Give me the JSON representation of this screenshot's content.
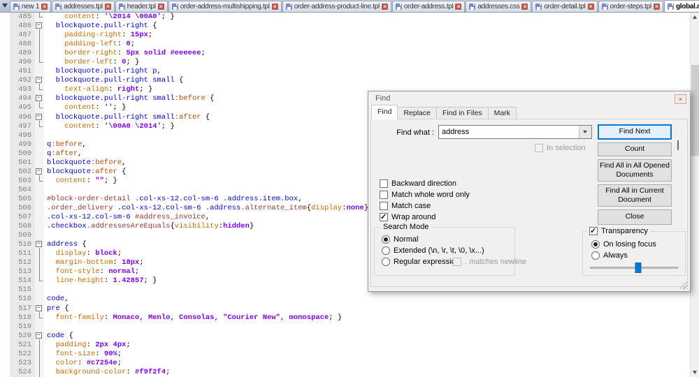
{
  "colors": {
    "accent": "#0078d7",
    "syntax_selector": "#0000e8",
    "syntax_property": "#cc6a00",
    "syntax_value": "#8000ff",
    "syntax_pseudo": "#c04800",
    "syntax_unknown": "#993333",
    "tab_close": "#c0564a",
    "tab_icon": "#8087c8"
  },
  "tabbar": {
    "tabs": [
      {
        "label": "new 1",
        "active": false
      },
      {
        "label": "addresses.tpl",
        "active": false
      },
      {
        "label": "header.tpl",
        "active": false
      },
      {
        "label": "order-address-multishipping.tpl",
        "active": false
      },
      {
        "label": "order-address-product-line.tpl",
        "active": false
      },
      {
        "label": "order-address.tpl",
        "active": false
      },
      {
        "label": "addresses.css",
        "active": false
      },
      {
        "label": "order-detail.tpl",
        "active": false
      },
      {
        "label": "order-steps.tpl",
        "active": false
      },
      {
        "label": "global.css",
        "active": true
      }
    ]
  },
  "editor": {
    "lines": [
      {
        "num": 485,
        "fold": "end",
        "segs": [
          [
            "pln",
            "    "
          ],
          [
            "prop",
            "content"
          ],
          [
            "pln",
            ": "
          ],
          [
            "val",
            "'\\2014 \\00A0'"
          ],
          [
            "pln",
            "; }"
          ]
        ]
      },
      {
        "num": 486,
        "fold": "box",
        "segs": [
          [
            "pln",
            "  "
          ],
          [
            "sel",
            "blockquote.pull-right"
          ],
          [
            "pln",
            " {"
          ]
        ]
      },
      {
        "num": 487,
        "fold": "line",
        "segs": [
          [
            "pln",
            "    "
          ],
          [
            "prop",
            "padding-right"
          ],
          [
            "pln",
            ": "
          ],
          [
            "val",
            "15px"
          ],
          [
            "pln",
            ";"
          ]
        ]
      },
      {
        "num": 488,
        "fold": "line",
        "segs": [
          [
            "pln",
            "    "
          ],
          [
            "prop",
            "padding-left"
          ],
          [
            "pln",
            ": "
          ],
          [
            "val",
            "0"
          ],
          [
            "pln",
            ";"
          ]
        ]
      },
      {
        "num": 489,
        "fold": "line",
        "segs": [
          [
            "pln",
            "    "
          ],
          [
            "prop",
            "border-right"
          ],
          [
            "pln",
            ": "
          ],
          [
            "val",
            "5px solid #eeeeee"
          ],
          [
            "pln",
            ";"
          ]
        ]
      },
      {
        "num": 490,
        "fold": "end",
        "segs": [
          [
            "pln",
            "    "
          ],
          [
            "prop",
            "border-left"
          ],
          [
            "pln",
            ": "
          ],
          [
            "val",
            "0"
          ],
          [
            "pln",
            "; }"
          ]
        ]
      },
      {
        "num": 491,
        "fold": "none",
        "segs": [
          [
            "pln",
            "  "
          ],
          [
            "sel",
            "blockquote.pull-right p"
          ],
          [
            "pln",
            ","
          ]
        ]
      },
      {
        "num": 492,
        "fold": "box",
        "segs": [
          [
            "pln",
            "  "
          ],
          [
            "sel",
            "blockquote.pull-right small"
          ],
          [
            "pln",
            " {"
          ]
        ]
      },
      {
        "num": 493,
        "fold": "end",
        "segs": [
          [
            "pln",
            "    "
          ],
          [
            "prop",
            "text-align"
          ],
          [
            "pln",
            ": "
          ],
          [
            "val",
            "right"
          ],
          [
            "pln",
            "; }"
          ]
        ]
      },
      {
        "num": 494,
        "fold": "box",
        "segs": [
          [
            "pln",
            "  "
          ],
          [
            "sel",
            "blockquote.pull-right small"
          ],
          [
            "pse",
            ":before"
          ],
          [
            "pln",
            " {"
          ]
        ]
      },
      {
        "num": 495,
        "fold": "end",
        "segs": [
          [
            "pln",
            "    "
          ],
          [
            "prop",
            "content"
          ],
          [
            "pln",
            ": "
          ],
          [
            "val",
            "''"
          ],
          [
            "pln",
            "; }"
          ]
        ]
      },
      {
        "num": 496,
        "fold": "box",
        "segs": [
          [
            "pln",
            "  "
          ],
          [
            "sel",
            "blockquote.pull-right small"
          ],
          [
            "pse",
            ":after"
          ],
          [
            "pln",
            " {"
          ]
        ]
      },
      {
        "num": 497,
        "fold": "end",
        "segs": [
          [
            "pln",
            "    "
          ],
          [
            "prop",
            "content"
          ],
          [
            "pln",
            ": "
          ],
          [
            "val",
            "'\\00A0 \\2014'"
          ],
          [
            "pln",
            "; }"
          ]
        ]
      },
      {
        "num": 498,
        "fold": "none",
        "segs": []
      },
      {
        "num": 499,
        "fold": "none",
        "segs": [
          [
            "sel",
            "q"
          ],
          [
            "pse",
            ":before"
          ],
          [
            "pln",
            ","
          ]
        ]
      },
      {
        "num": 500,
        "fold": "none",
        "segs": [
          [
            "sel",
            "q"
          ],
          [
            "pse",
            ":after"
          ],
          [
            "pln",
            ","
          ]
        ]
      },
      {
        "num": 501,
        "fold": "none",
        "segs": [
          [
            "sel",
            "blockquote"
          ],
          [
            "pse",
            ":before"
          ],
          [
            "pln",
            ","
          ]
        ]
      },
      {
        "num": 502,
        "fold": "box",
        "segs": [
          [
            "sel",
            "blockquote"
          ],
          [
            "pse",
            ":after"
          ],
          [
            "pln",
            " {"
          ]
        ]
      },
      {
        "num": 503,
        "fold": "end",
        "segs": [
          [
            "pln",
            "  "
          ],
          [
            "prop",
            "content"
          ],
          [
            "pln",
            ": "
          ],
          [
            "val",
            "\"\""
          ],
          [
            "pln",
            "; }"
          ]
        ]
      },
      {
        "num": 504,
        "fold": "none",
        "segs": []
      },
      {
        "num": 505,
        "fold": "none",
        "segs": [
          [
            "unk",
            "#block-order-detail"
          ],
          [
            "pln",
            " "
          ],
          [
            "sel",
            ".col-xs-12.col-sm-6"
          ],
          [
            "pln",
            " "
          ],
          [
            "sel",
            ".address.item.box"
          ],
          [
            "pln",
            ","
          ]
        ]
      },
      {
        "num": 506,
        "fold": "none",
        "segs": [
          [
            "unk",
            ".order_delivery"
          ],
          [
            "pln",
            " "
          ],
          [
            "sel",
            ".col-xs-12.col-sm-6"
          ],
          [
            "pln",
            " "
          ],
          [
            "sel",
            ".address"
          ],
          [
            "unk",
            ".alternate_item"
          ],
          [
            "pln",
            "{"
          ],
          [
            "prop",
            "display"
          ],
          [
            "pln",
            ":"
          ],
          [
            "val",
            "none"
          ],
          [
            "pln",
            "}"
          ]
        ]
      },
      {
        "num": 507,
        "fold": "none",
        "segs": [
          [
            "sel",
            ".col-xs-12.col-sm-6"
          ],
          [
            "pln",
            " "
          ],
          [
            "unk",
            "#address_invoice"
          ],
          [
            "pln",
            ","
          ]
        ]
      },
      {
        "num": 508,
        "fold": "none",
        "segs": [
          [
            "sel",
            ".checkbox"
          ],
          [
            "unk",
            ".addressesAreEquals"
          ],
          [
            "pln",
            "{"
          ],
          [
            "prop",
            "visibility"
          ],
          [
            "pln",
            ":"
          ],
          [
            "val",
            "hidden"
          ],
          [
            "pln",
            "}"
          ]
        ]
      },
      {
        "num": 509,
        "fold": "none",
        "segs": []
      },
      {
        "num": 510,
        "fold": "box",
        "segs": [
          [
            "sel",
            "address"
          ],
          [
            "pln",
            " {"
          ]
        ]
      },
      {
        "num": 511,
        "fold": "line",
        "segs": [
          [
            "pln",
            "  "
          ],
          [
            "prop",
            "display"
          ],
          [
            "pln",
            ": "
          ],
          [
            "val",
            "block"
          ],
          [
            "pln",
            ";"
          ]
        ]
      },
      {
        "num": 512,
        "fold": "line",
        "segs": [
          [
            "pln",
            "  "
          ],
          [
            "prop",
            "margin-bottom"
          ],
          [
            "pln",
            ": "
          ],
          [
            "val",
            "18px"
          ],
          [
            "pln",
            ";"
          ]
        ]
      },
      {
        "num": 513,
        "fold": "line",
        "segs": [
          [
            "pln",
            "  "
          ],
          [
            "prop",
            "font-style"
          ],
          [
            "pln",
            ": "
          ],
          [
            "val",
            "normal"
          ],
          [
            "pln",
            ";"
          ]
        ]
      },
      {
        "num": 514,
        "fold": "end",
        "segs": [
          [
            "pln",
            "  "
          ],
          [
            "prop",
            "line-height"
          ],
          [
            "pln",
            ": "
          ],
          [
            "val",
            "1.42857"
          ],
          [
            "pln",
            "; }"
          ]
        ]
      },
      {
        "num": 515,
        "fold": "none",
        "segs": []
      },
      {
        "num": 516,
        "fold": "none",
        "segs": [
          [
            "sel",
            "code"
          ],
          [
            "pln",
            ","
          ]
        ]
      },
      {
        "num": 517,
        "fold": "box",
        "segs": [
          [
            "sel",
            "pre"
          ],
          [
            "pln",
            " {"
          ]
        ]
      },
      {
        "num": 518,
        "fold": "end",
        "segs": [
          [
            "pln",
            "  "
          ],
          [
            "prop",
            "font-family"
          ],
          [
            "pln",
            ": "
          ],
          [
            "val",
            "Monaco, Menlo, Consolas, \"Courier New\", monospace"
          ],
          [
            "pln",
            "; }"
          ]
        ]
      },
      {
        "num": 519,
        "fold": "none",
        "segs": []
      },
      {
        "num": 520,
        "fold": "box",
        "segs": [
          [
            "sel",
            "code"
          ],
          [
            "pln",
            " {"
          ]
        ]
      },
      {
        "num": 521,
        "fold": "line",
        "segs": [
          [
            "pln",
            "  "
          ],
          [
            "prop",
            "padding"
          ],
          [
            "pln",
            ": "
          ],
          [
            "val",
            "2px 4px"
          ],
          [
            "pln",
            ";"
          ]
        ]
      },
      {
        "num": 522,
        "fold": "line",
        "segs": [
          [
            "pln",
            "  "
          ],
          [
            "prop",
            "font-size"
          ],
          [
            "pln",
            ": "
          ],
          [
            "val",
            "90%"
          ],
          [
            "pln",
            ";"
          ]
        ]
      },
      {
        "num": 523,
        "fold": "line",
        "segs": [
          [
            "pln",
            "  "
          ],
          [
            "prop",
            "color"
          ],
          [
            "pln",
            ": "
          ],
          [
            "val",
            "#c7254e"
          ],
          [
            "pln",
            ";"
          ]
        ]
      },
      {
        "num": 524,
        "fold": "line",
        "segs": [
          [
            "pln",
            "  "
          ],
          [
            "prop",
            "background-color"
          ],
          [
            "pln",
            ": "
          ],
          [
            "val",
            "#f9f2f4"
          ],
          [
            "pln",
            ";"
          ]
        ]
      }
    ]
  },
  "find_dialog": {
    "title": "Find",
    "tabs": [
      {
        "label": "Find",
        "active": true
      },
      {
        "label": "Replace",
        "active": false
      },
      {
        "label": "Find in Files",
        "active": false
      },
      {
        "label": "Mark",
        "active": false
      }
    ],
    "find_what": {
      "label": "Find what :",
      "value": "address"
    },
    "buttons": {
      "find_next": "Find Next",
      "count": "Count",
      "find_all_opened": "Find All in All Opened Documents",
      "find_all_current": "Find All in Current Document",
      "close": "Close"
    },
    "options": [
      {
        "label": "In selection",
        "checked": false,
        "disabled": true
      },
      {
        "label": "Backward direction",
        "checked": false,
        "disabled": false
      },
      {
        "label": "Match whole word only",
        "checked": false,
        "disabled": false
      },
      {
        "label": "Match case",
        "checked": false,
        "disabled": false
      },
      {
        "label": "Wrap around",
        "checked": true,
        "disabled": false
      }
    ],
    "search_mode": {
      "label": "Search Mode",
      "radios": [
        {
          "label": "Normal",
          "selected": true
        },
        {
          "label": "Extended (\\n, \\r, \\t, \\0, \\x...)",
          "selected": false
        },
        {
          "label": "Regular expression",
          "selected": false
        }
      ],
      "matches_newline": {
        "label": ". matches newline",
        "checked": false,
        "disabled": true
      }
    },
    "transparency": {
      "label": "Transparency",
      "checked": true,
      "radios": [
        {
          "label": "On losing focus",
          "selected": true
        },
        {
          "label": "Always",
          "selected": false
        }
      ],
      "slider_percent": 55
    }
  }
}
